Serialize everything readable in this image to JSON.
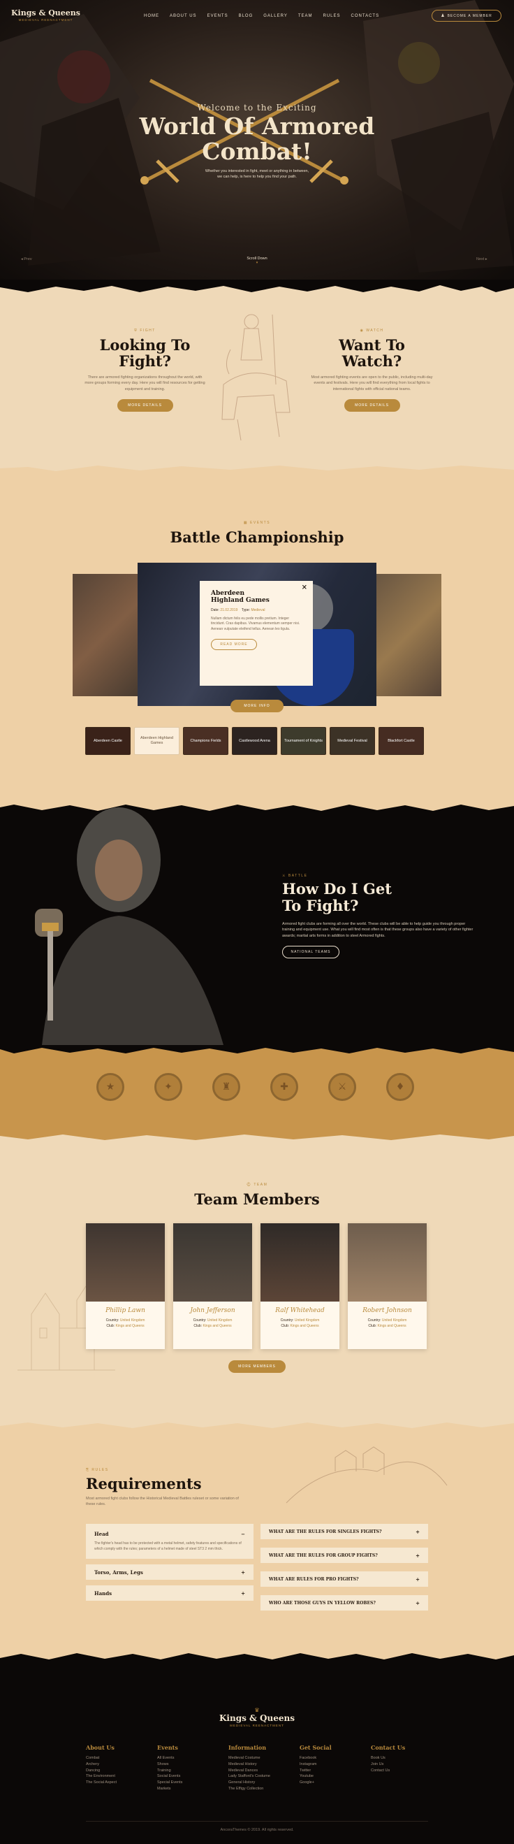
{
  "brand": {
    "name_top": "Kings & Queens",
    "name_sub": "Medieval Reenactment"
  },
  "nav": {
    "items": [
      "Home",
      "About Us",
      "Events",
      "Blog",
      "Gallery",
      "Team",
      "Rules",
      "Contacts"
    ],
    "cta": "Become a Member"
  },
  "hero": {
    "welcome": "Welcome to the Exciting",
    "title_line1": "World Of Armored",
    "title_line2": "Combat!",
    "text": "Whether you interested in fight, meet or anything in between, we can help, is here to help you find your path.",
    "prev": "Prev",
    "next": "Next",
    "scroll": "Scroll Down"
  },
  "fight": {
    "eyebrow": "Fight",
    "title1": "Looking To",
    "title2": "Fight?",
    "text": "There are armored fighting organizations throughout the world, with more groups forming every day. Here you will find resources for getting equipment and training.",
    "button": "More Details"
  },
  "watch": {
    "eyebrow": "Watch",
    "title1": "Want To",
    "title2": "Watch?",
    "text": "Most armored fighting events are open to the public, including multi-day events and festivals. Here you will find everything from local fights to international fights with official national teams.",
    "button": "More Details"
  },
  "events": {
    "eyebrow": "Events",
    "title": "Battle Championship",
    "popup": {
      "title1": "Aberdeen",
      "title2": "Highland Games",
      "date_label": "Date:",
      "date": "21.02.2019",
      "type_label": "Type:",
      "type": "Medieval",
      "text": "Nullam dictum felis eu pede mollis pretium. Integer tincidunt. Cras dapibus. Vivamus elementum semper nisi. Aenean vulputate eleifend tellus. Aenean leo ligula.",
      "button": "Read More",
      "close": "×"
    },
    "more_button": "More Info",
    "thumbs": [
      "Aberdeen Castle",
      "Aberdeen Highland Games",
      "Champions Fields",
      "Castlewood Arena",
      "Tournament of Knights",
      "Medieval Festival",
      "Blackfort Castle"
    ]
  },
  "battle": {
    "eyebrow": "Battle",
    "title1": "How Do I Get",
    "title2": "To Fight?",
    "text": "Armored fight clubs are forming all over the world. These clubs will be able to help guide you through proper training and equipment use. What you will find most often is that these groups also have a variety of other fighter awards; martial arts forms in addition to steel Armored fights.",
    "button": "National Teams"
  },
  "badges": [
    "★",
    "✦",
    "♜",
    "✚",
    "⚔",
    "♦"
  ],
  "team": {
    "eyebrow": "Team",
    "title": "Team Members",
    "country_label": "Country:",
    "club_label": "Club:",
    "members": [
      {
        "name": "Phillip Lawn",
        "country": "United Kingdom",
        "club": "Kings and Queens"
      },
      {
        "name": "John Jefferson",
        "country": "United Kingdom",
        "club": "Kings and Queens"
      },
      {
        "name": "Ralf Whitehead",
        "country": "United Kingdom",
        "club": "Kings and Queens"
      },
      {
        "name": "Robert Johnson",
        "country": "United Kingdom",
        "club": "Kings and Queens"
      }
    ],
    "button": "More Members"
  },
  "rules": {
    "eyebrow": "Rules",
    "title": "Requirements",
    "intro": "Most armored fight clubs follow the Historical Medieval Battles ruleset or some variation of these rules.",
    "left": [
      {
        "title": "Head",
        "text": "The fighter's head has to be protected with a metal helmet, safety features and specifications of which comply with the rules; parameters of a helmet made of steel ST3 2 mm thick."
      },
      {
        "title": "Torso, Arms, Legs"
      },
      {
        "title": "Hands"
      }
    ],
    "right": [
      "What are the rules for singles fights?",
      "What are the rules for group fights?",
      "What are rules for pro fights?",
      "Who are those guys in yellow robes?"
    ]
  },
  "footer": {
    "cols": [
      {
        "title": "About Us",
        "links": [
          "Combat",
          "Archery",
          "Dancing",
          "The Environment",
          "The Social Aspect"
        ]
      },
      {
        "title": "Events",
        "links": [
          "All Events",
          "Shows",
          "Training",
          "Social Events",
          "Special Events",
          "Markets"
        ]
      },
      {
        "title": "Information",
        "links": [
          "Medieval Costume",
          "Medieval History",
          "Medieval Dances",
          "Lady Stafford's Costume",
          "General History",
          "The Effigy Collection"
        ]
      },
      {
        "title": "Get Social",
        "links": [
          "Facebook",
          "Instagram",
          "Twitter",
          "Youtube",
          "Google+"
        ]
      },
      {
        "title": "Contact Us",
        "links": [
          "Book Us",
          "Join Us",
          "Contact Us"
        ]
      }
    ],
    "copyright": "AncoraThemes © 2019. All rights reserved."
  },
  "colors": {
    "accent": "#b98a3c",
    "parchment": "#efd9b8",
    "dark": "#0b0807"
  }
}
